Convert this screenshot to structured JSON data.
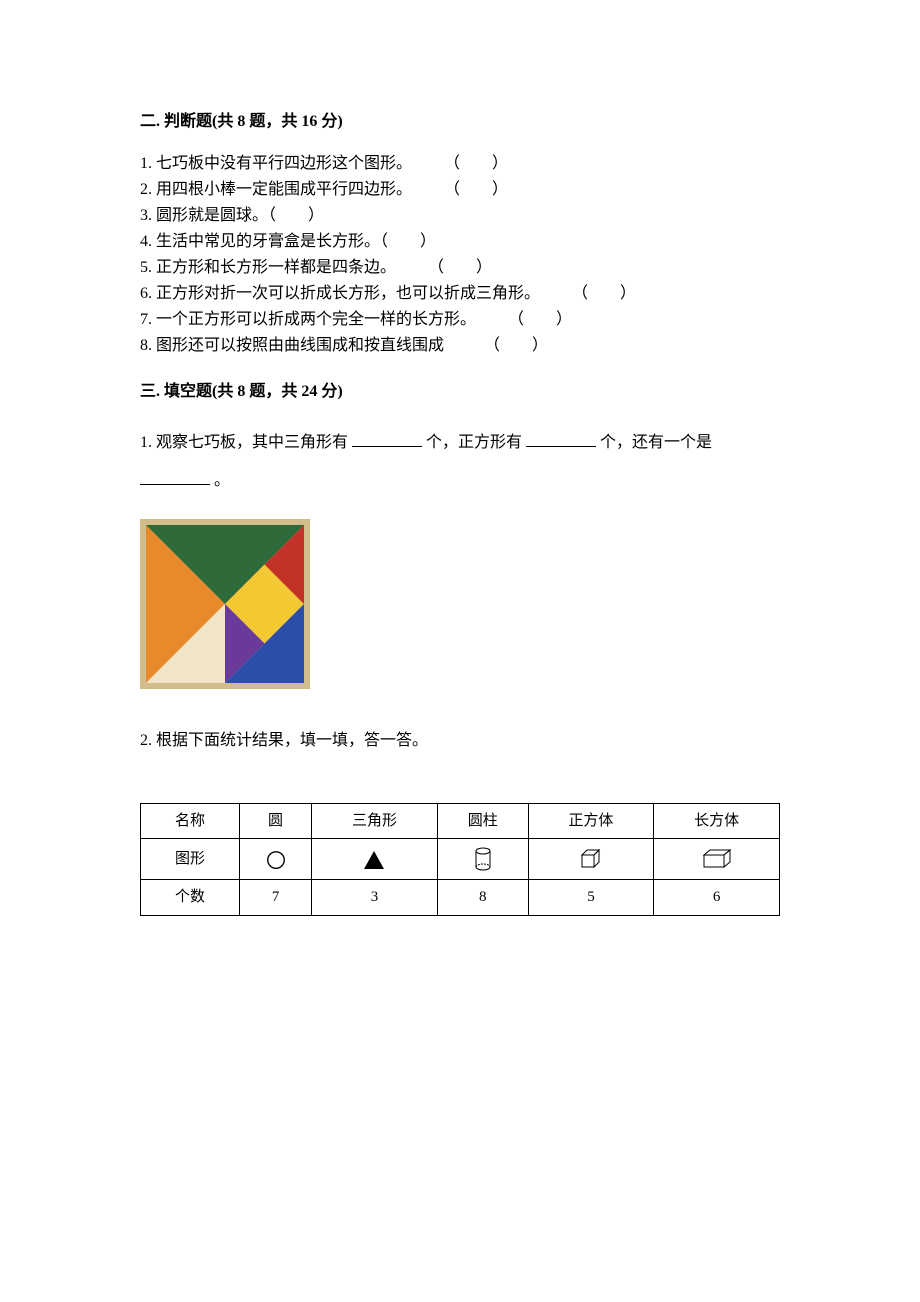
{
  "section2": {
    "title": "二. 判断题(共 8 题，共 16 分)",
    "items": [
      "1. 七巧板中没有平行四边形这个图形。　　　（　　）",
      "2. 用四根小棒一定能围成平行四边形。　　　（　　）",
      "3. 圆形就是圆球。（　　）",
      "4. 生活中常见的牙膏盒是长方形。（　　）",
      "5. 正方形和长方形一样都是四条边。　　　（　　）",
      "6. 正方形对折一次可以折成长方形，也可以折成三角形。　　　（　　）",
      "7. 一个正方形可以折成两个完全一样的长方形。　　　（　　）",
      "8. 图形还可以按照由曲线围成和按直线围成　　　（　　）"
    ]
  },
  "section3": {
    "title": "三. 填空题(共 8 题，共 24 分)",
    "q1_parts": {
      "p1": "1. 观察七巧板，其中三角形有",
      "p2": "个，正方形有",
      "p3": "个，还有一个是",
      "p4": "。"
    },
    "q2": "2. 根据下面统计结果，填一填，答一答。",
    "table": {
      "row_labels": [
        "名称",
        "图形",
        "个数"
      ],
      "headers": [
        "圆",
        "三角形",
        "圆柱",
        "正方体",
        "长方体"
      ],
      "shape_icons": [
        "circle-icon",
        "triangle-icon",
        "cylinder-icon",
        "cube-icon",
        "cuboid-icon"
      ],
      "counts": [
        "7",
        "3",
        "8",
        "5",
        "6"
      ]
    }
  }
}
